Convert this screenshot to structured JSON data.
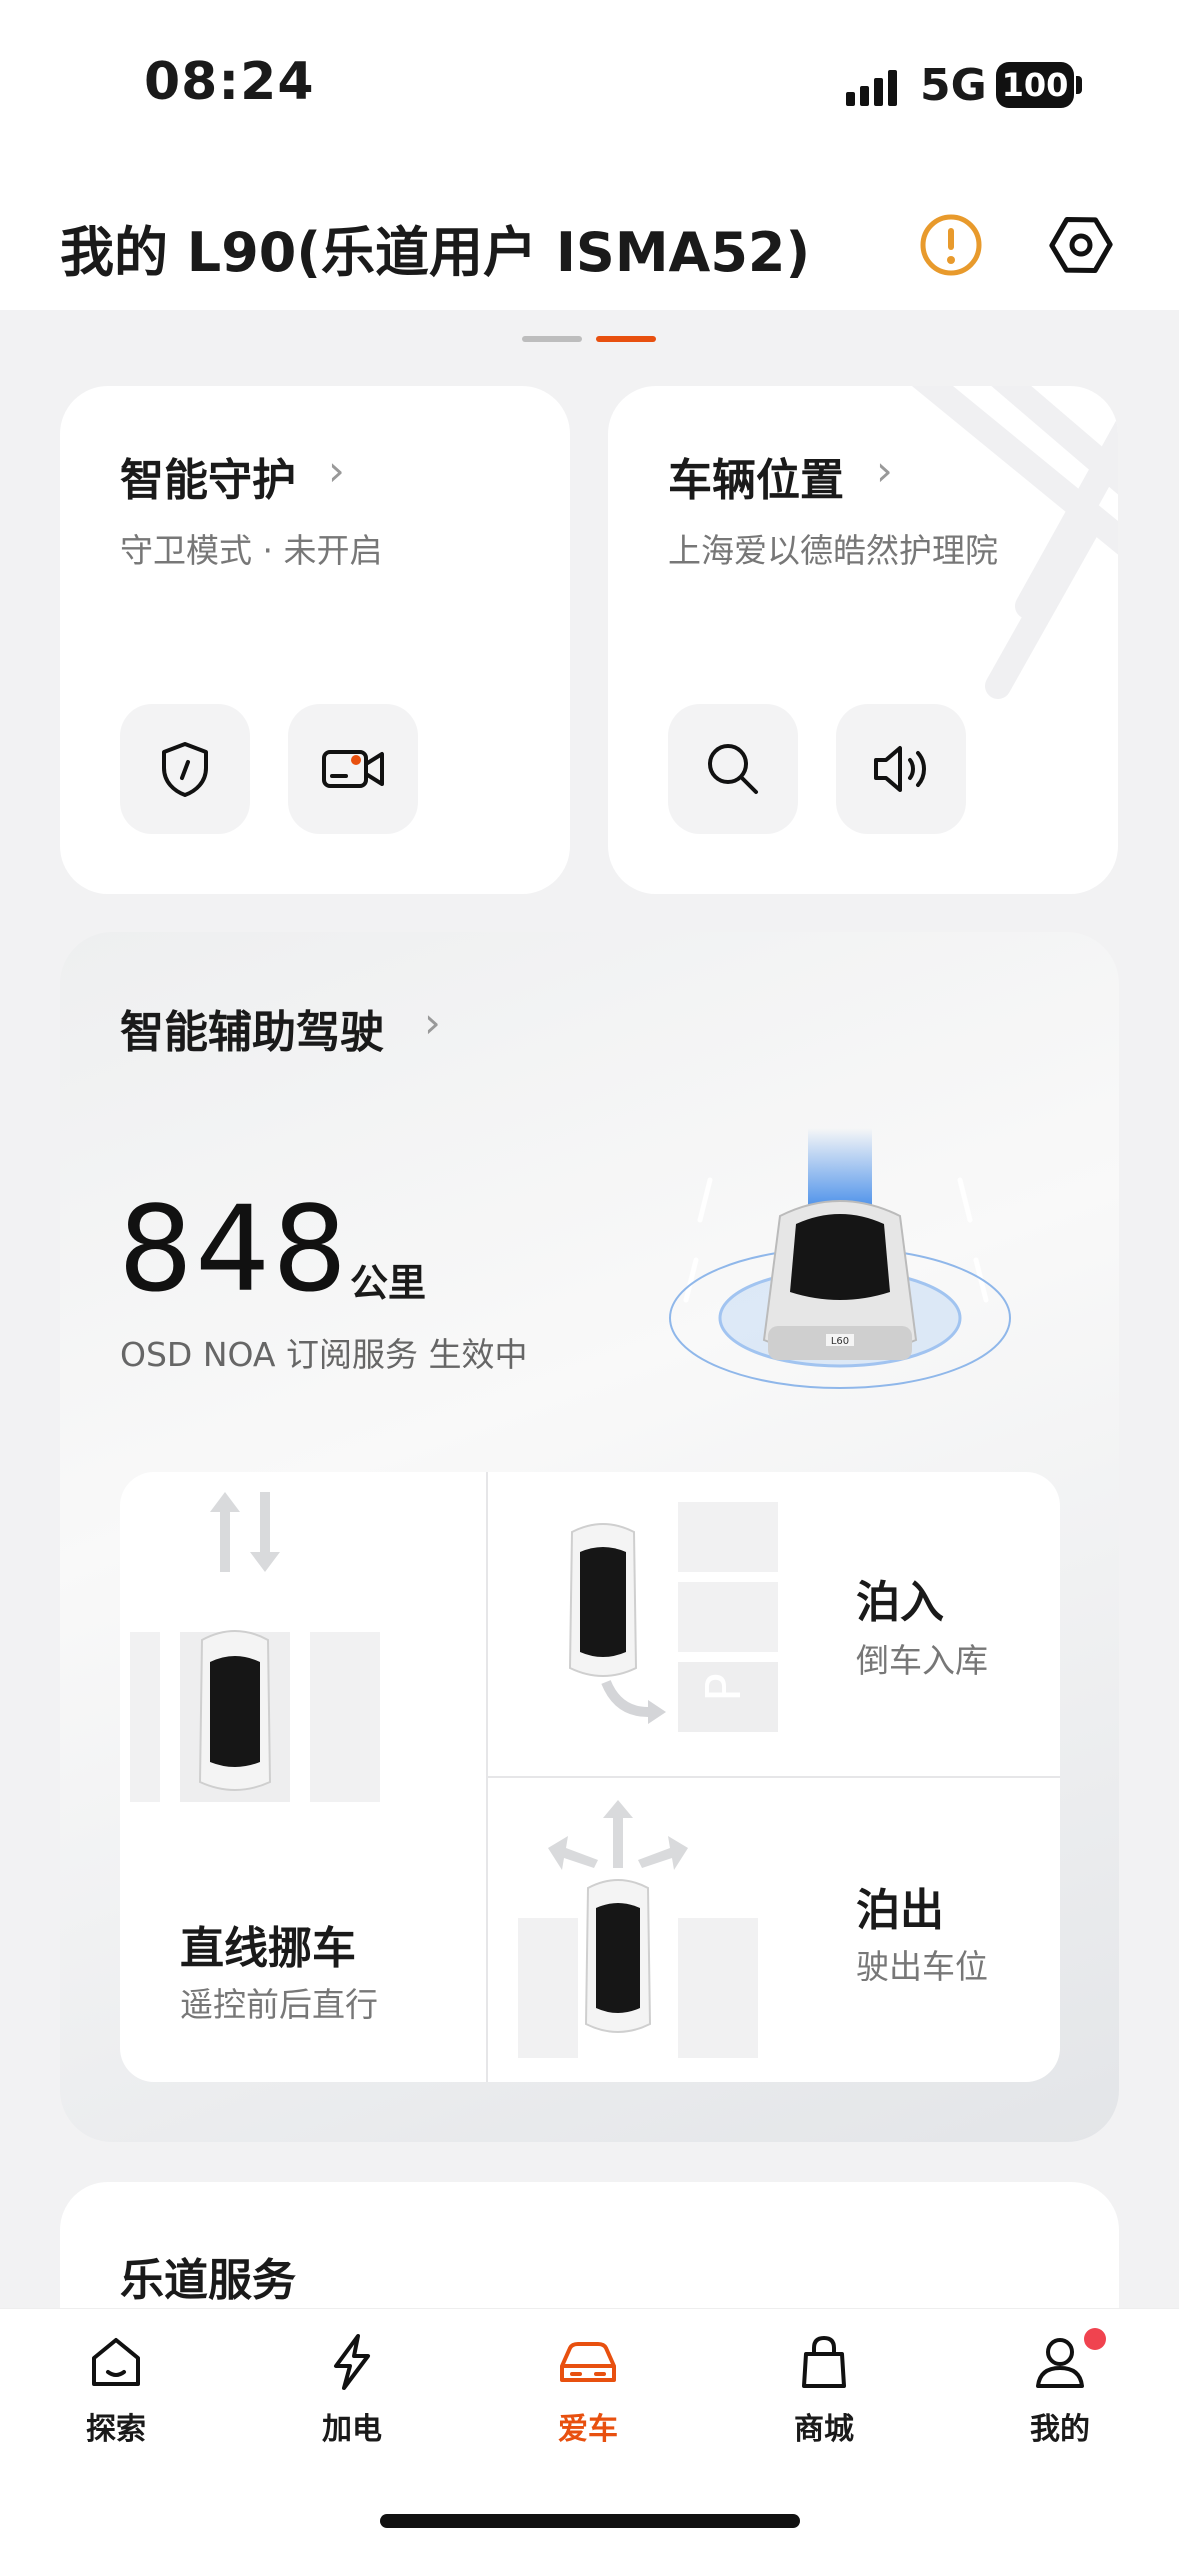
{
  "status": {
    "time": "08:24",
    "network": "5G",
    "battery": "100"
  },
  "header": {
    "title": "我的 L90(乐道用户 ISMA52)"
  },
  "guard_card": {
    "title": "智能守护",
    "subtitle": "守卫模式 · 未开启"
  },
  "location_card": {
    "title": "车辆位置",
    "subtitle": "上海爱以德皓然护理院"
  },
  "assist": {
    "title": "智能辅助驾驶",
    "distance_value": "848",
    "distance_unit": "公里",
    "subscription": "OSD NOA 订阅服务 生效中",
    "car_plate": "L60",
    "tiles": {
      "straight": {
        "title": "直线挪车",
        "sub": "遥控前后直行"
      },
      "park_in": {
        "title": "泊入",
        "sub": "倒车入库"
      },
      "park_out": {
        "title": "泊出",
        "sub": "驶出车位"
      }
    }
  },
  "service": {
    "title": "乐道服务"
  },
  "nav": {
    "items": [
      {
        "label": "探索",
        "icon": "home-icon"
      },
      {
        "label": "加电",
        "icon": "lightning-icon"
      },
      {
        "label": "爱车",
        "icon": "car-icon"
      },
      {
        "label": "商城",
        "icon": "shopping-bag-icon"
      },
      {
        "label": "我的",
        "icon": "user-icon"
      }
    ]
  },
  "colors": {
    "accent": "#e8500f",
    "warning": "#e89a2c",
    "text": "#1a1a1a",
    "muted": "#777777"
  }
}
